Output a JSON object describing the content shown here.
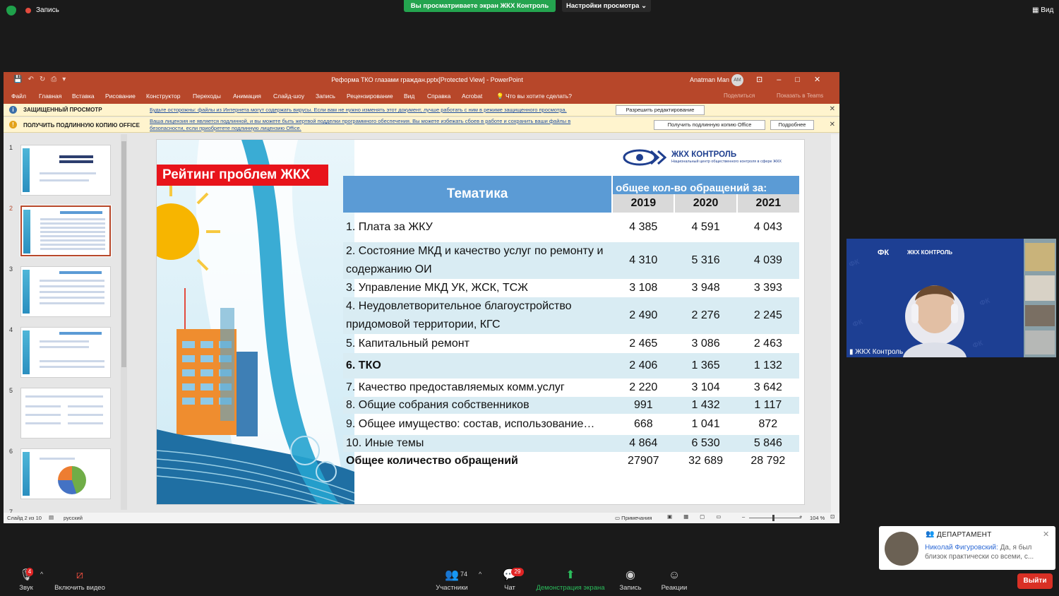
{
  "zoom_top": {
    "record_label": "Запись",
    "share_banner": "Вы просматриваете экран ЖКХ Контроль",
    "view_settings": "Настройки просмотра ⌄",
    "view_button": "Вид"
  },
  "ppt": {
    "title": "Реформа ТКО глазами граждан.pptx[Protected View]  -  PowerPoint",
    "user_name": "Anatman Man",
    "user_initials": "AM",
    "menu": [
      "Файл",
      "Главная",
      "Вставка",
      "Рисование",
      "Конструктор",
      "Переходы",
      "Анимация",
      "Слайд-шоу",
      "Запись",
      "Рецензирование",
      "Вид",
      "Справка",
      "Acrobat"
    ],
    "tell_me": "Что вы хотите сделать?",
    "share": "Поделиться",
    "teams": "Показать в Teams",
    "protected_bar": {
      "title": "ЗАЩИЩЕННЫЙ ПРОСМОТР",
      "text": "Будьте осторожны: файлы из Интернета могут содержать вирусы. Если вам не нужно изменять этот документ, лучше работать с ним в режиме защищенного просмотра.",
      "button": "Разрешить редактирование"
    },
    "license_bar": {
      "title": "ПОЛУЧИТЬ ПОДЛИННУЮ КОПИЮ OFFICE",
      "text1": "Ваша лицензия не является подлинной, и вы можете быть жертвой подделки программного обеспечения. Вы можете избежать сбоев в работе и сохранить ваши файлы в",
      "text2": "безопасности, если приобретете подлинную лицензию Office.",
      "button1": "Получить подлинную копию Office",
      "button2": "Подробнее"
    },
    "thumbnails": [
      "1",
      "2",
      "3",
      "4",
      "5",
      "6",
      "7"
    ],
    "statusbar": {
      "slide": "Слайд 2 из 10",
      "lang": "русский",
      "notes": "Примечания",
      "zoom": "104 %"
    }
  },
  "slide": {
    "title": "Рейтинг проблем ЖКХ",
    "logo_name": "ЖКХ КОНТРОЛЬ",
    "logo_sub": "Национальный центр общественного контроля в сфере ЖКХ",
    "header_topic": "Тематика",
    "header_total": "общее кол-во обращений за:",
    "years": [
      "2019",
      "2020",
      "2021"
    ],
    "rows": [
      {
        "label": "1. Плата за ЖКУ",
        "v": [
          "4 385",
          "4 591",
          "4 043"
        ]
      },
      {
        "label": "2. Состояние МКД и качество услуг по ремонту и содержанию ОИ",
        "v": [
          "4 310",
          "5 316",
          "4 039"
        ]
      },
      {
        "label": "3. Управление МКД УК, ЖСК, ТСЖ",
        "v": [
          "3 108",
          "3 948",
          "3 393"
        ]
      },
      {
        "label": "4. Неудовлетворительное благоустройство придомовой территории, КГС",
        "v": [
          "2 490",
          "2 276",
          "2 245"
        ]
      },
      {
        "label": "5. Капитальный ремонт",
        "v": [
          "2 465",
          "3 086",
          "2 463"
        ]
      },
      {
        "label": "6. ТКО",
        "v": [
          "2 406",
          "1 365",
          "1 132"
        ]
      },
      {
        "label": "7. Качество предоставляемых комм.услуг",
        "v": [
          "2 220",
          "3 104",
          "3 642"
        ]
      },
      {
        "label": "8. Общие собрания собственников",
        "v": [
          "991",
          "1 432",
          "1 117"
        ]
      },
      {
        "label": "9. Общее имущество: состав, использование…",
        "v": [
          "668",
          "1 041",
          "872"
        ]
      },
      {
        "label": "10. Иные темы",
        "v": [
          "4 864",
          "6 530",
          "5 846"
        ]
      },
      {
        "label": "Общее количество обращений",
        "v": [
          "27907",
          "32 689",
          "28 792"
        ]
      }
    ]
  },
  "video": {
    "name": "ЖКХ Контроль",
    "logo": "ЖКХ КОНТРОЛЬ"
  },
  "notification": {
    "channel": "ДЕПАРТАМЕНТ",
    "sender": "Николай Фигуровский:",
    "message": "Да, я был близок практически со всеми, с..."
  },
  "toolbar": {
    "audio": "Звук",
    "video": "Включить видео",
    "participants": "Участники",
    "participants_count": "74",
    "chat": "Чат",
    "chat_badge": "29",
    "share": "Демонстрация экрана",
    "record": "Запись",
    "reactions": "Реакции",
    "leave": "Выйти",
    "audio_badge": "4"
  }
}
